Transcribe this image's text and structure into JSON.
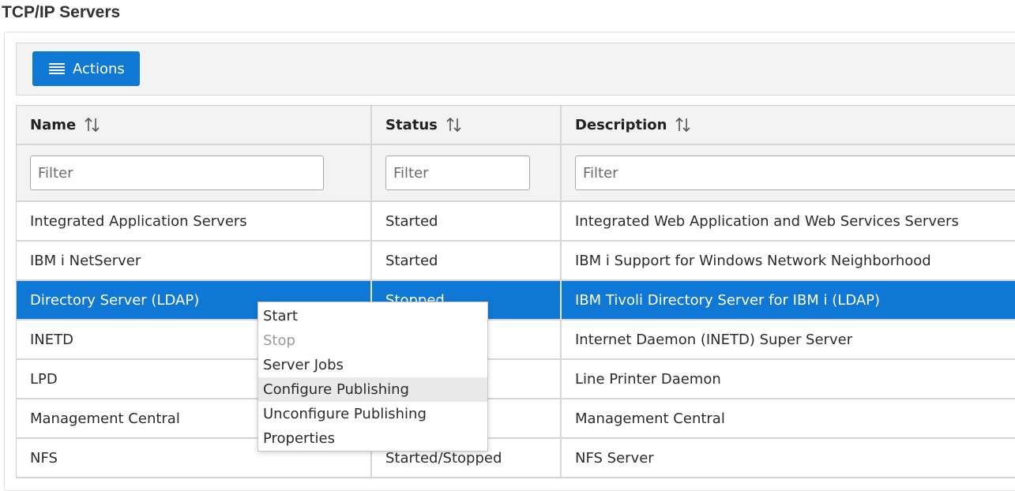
{
  "page_title": "TCP/IP Servers",
  "toolbar": {
    "actions_label": "Actions"
  },
  "columns": [
    {
      "label": "Name",
      "filter_placeholder": "Filter"
    },
    {
      "label": "Status",
      "filter_placeholder": "Filter"
    },
    {
      "label": "Description",
      "filter_placeholder": "Filter"
    }
  ],
  "rows": [
    {
      "name": "Integrated Application Servers",
      "status": "Started",
      "description": "Integrated Web Application and Web Services Servers"
    },
    {
      "name": "IBM i NetServer",
      "status": "Started",
      "description": "IBM i Support for Windows Network Neighborhood"
    },
    {
      "name": "Directory Server (LDAP)",
      "status": "Stopped",
      "description": "IBM Tivoli Directory Server for IBM i (LDAP)",
      "selected": true
    },
    {
      "name": "INETD",
      "status": "",
      "description": "Internet Daemon (INETD) Super Server"
    },
    {
      "name": "LPD",
      "status": "",
      "description": "Line Printer Daemon"
    },
    {
      "name": "Management Central",
      "status": "",
      "description": "Management Central"
    },
    {
      "name": "NFS",
      "status": "Started/Stopped",
      "description": "NFS Server"
    }
  ],
  "context_menu": [
    {
      "label": "Start",
      "enabled": true
    },
    {
      "label": "Stop",
      "enabled": false
    },
    {
      "label": "Server Jobs",
      "enabled": true
    },
    {
      "label": "Configure Publishing",
      "enabled": true,
      "hovered": true
    },
    {
      "label": "Unconfigure Publishing",
      "enabled": true
    },
    {
      "label": "Properties",
      "enabled": true
    }
  ],
  "colors": {
    "accent": "#0f78d4",
    "header_bg": "#f3f3f3"
  }
}
